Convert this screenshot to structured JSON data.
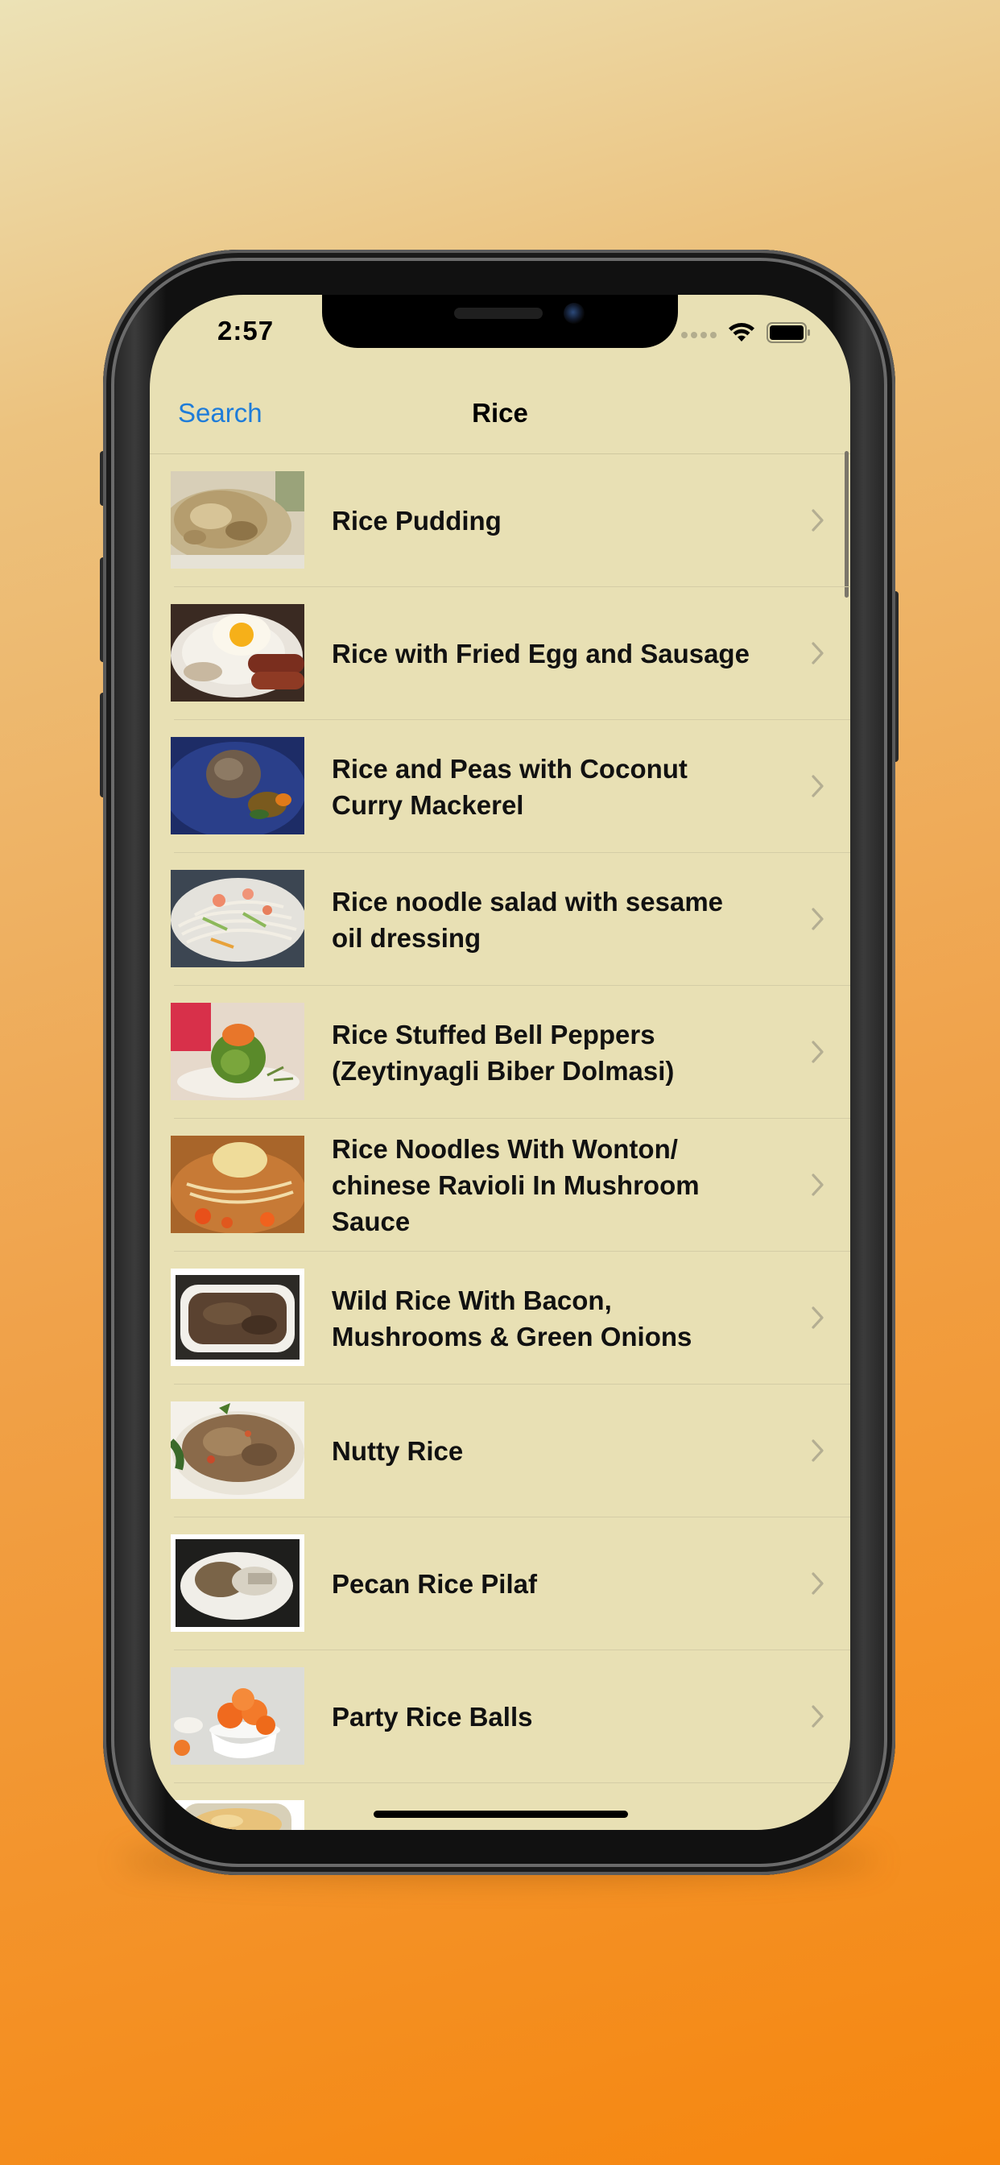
{
  "status": {
    "time": "2:57"
  },
  "nav": {
    "back_label": "Search",
    "title": "Rice"
  },
  "recipes": [
    {
      "title": "Rice Pudding"
    },
    {
      "title": "Rice with Fried Egg and Sausage"
    },
    {
      "title": "Rice and Peas with Coconut Curry Mackerel"
    },
    {
      "title": "Rice noodle salad with sesame oil dressing"
    },
    {
      "title": "Rice Stuffed Bell Peppers (Zeytinyagli Biber Dolmasi)"
    },
    {
      "title": "Rice Noodles With Wonton/ chinese Ravioli In Mushroom Sauce"
    },
    {
      "title": "Wild Rice With Bacon, Mushrooms & Green Onions"
    },
    {
      "title": "Nutty Rice"
    },
    {
      "title": "Pecan Rice Pilaf"
    },
    {
      "title": "Party Rice Balls"
    },
    {
      "title": ""
    }
  ],
  "colors": {
    "background_top": "#ece2b6",
    "background_bottom": "#f6860e",
    "screen_background": "#e8e0b4",
    "accent": "#1e7cd9"
  }
}
